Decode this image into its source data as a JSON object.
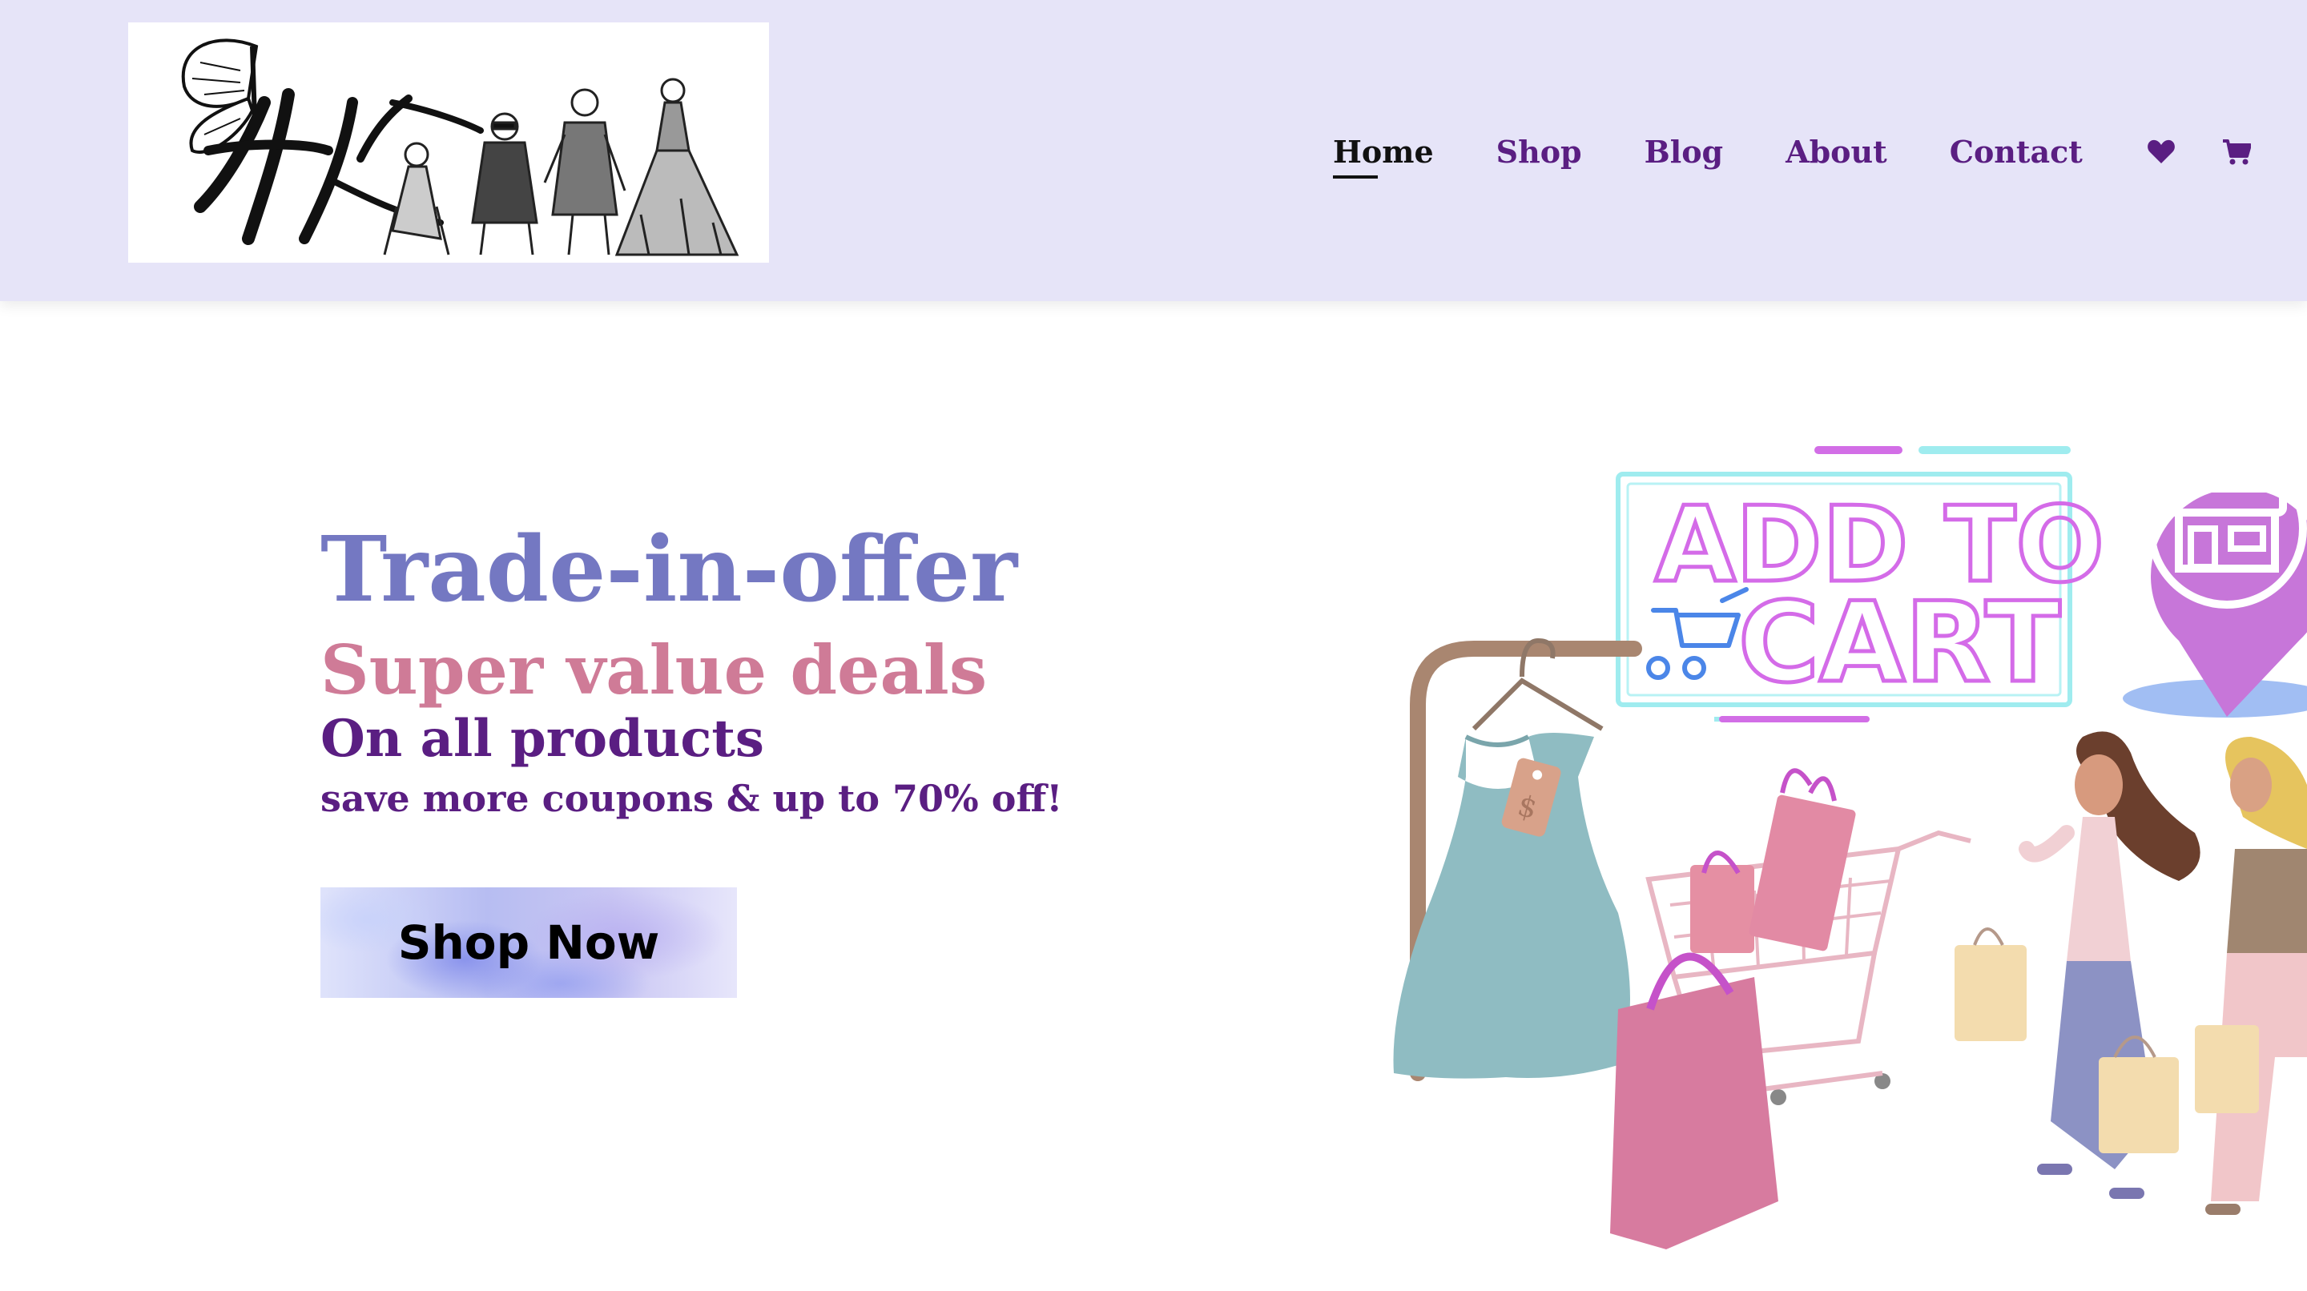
{
  "header": {
    "logo_alt": "logo",
    "nav": {
      "home": "Home",
      "shop": "Shop",
      "blog": "Blog",
      "about": "About",
      "contact": "Contact"
    },
    "icons": [
      "heart-icon",
      "cart-icon"
    ]
  },
  "hero": {
    "title": "Trade-in-offer",
    "subtitle": "Super value deals",
    "line2": "On all products",
    "line3": "save more coupons & up to 70% off!",
    "button": "Shop Now"
  },
  "illustration": {
    "neon_line1": "ADD TO",
    "neon_line2": "CART",
    "price_tag": "$"
  },
  "colors": {
    "header_bg": "#e6e4f8",
    "nav_text": "#5a1e82",
    "nav_active": "#111111",
    "title": "#7478c2",
    "subtitle": "#cf7b97",
    "body_text": "#5a1e82"
  }
}
